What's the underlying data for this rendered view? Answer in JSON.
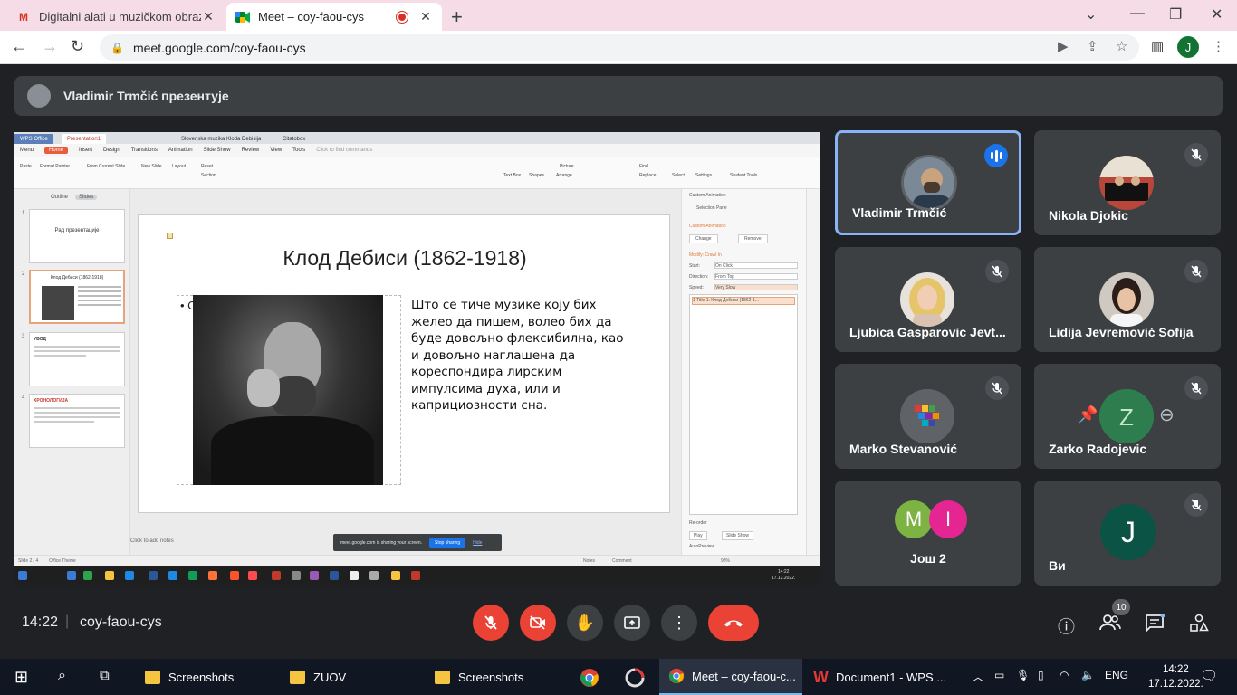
{
  "browser": {
    "tabs": [
      {
        "title": "Digitalni alati u muzičkom obrazc",
        "favicon": "gmail-icon"
      },
      {
        "title": "Meet – coy-faou-cys",
        "favicon": "meet-icon"
      }
    ],
    "url": "meet.google.com/coy-faou-cys",
    "profile_initial": "J"
  },
  "meet": {
    "presenter_text": "Vladimir Trmčić презентује",
    "time": "14:22",
    "separator": "|",
    "meeting_code": "coy-faou-cys",
    "participant_count": "10",
    "participants": [
      {
        "name": "Vladimir Trmčić",
        "status": "speaking"
      },
      {
        "name": "Nikola Djokic",
        "status": "muted"
      },
      {
        "name": "Ljubica Gasparovic Jevt...",
        "status": "muted"
      },
      {
        "name": "Lidija Jevremović Sofija",
        "status": "muted"
      },
      {
        "name": "Marko Stevanović",
        "status": "muted"
      },
      {
        "name": "Zarko Radojevic",
        "status": "muted"
      },
      {
        "name": "Још 2",
        "initials": [
          "M",
          "I"
        ]
      },
      {
        "name": "Ви",
        "initial": "J",
        "status": "muted"
      }
    ]
  },
  "shared": {
    "wps_tabs": [
      "WPS Office",
      "Presentation1",
      "Slovenska muzika Kloda Debisija",
      "Citatobox"
    ],
    "menu": [
      "Menu",
      "Home",
      "Insert",
      "Design",
      "Transitions",
      "Animation",
      "Slide Show",
      "Review",
      "View",
      "Tools",
      "Click to find commands"
    ],
    "ribbon": [
      "Paste",
      "Format Painter",
      "From Current Slide",
      "New Slide",
      "Layout",
      "Reset",
      "Section",
      "Picture",
      "Text Box",
      "Shapes",
      "Arrange",
      "Find",
      "Replace",
      "Select",
      "Settings",
      "Student Tools"
    ],
    "outline_tab": "Outline",
    "slides_tab": "Slides",
    "thumbnails": [
      {
        "num": "1",
        "title": "Рад презентације"
      },
      {
        "num": "2",
        "title": "Клод Дебиси (1862-1918)"
      },
      {
        "num": "3",
        "title": "УВОД"
      },
      {
        "num": "4",
        "title": "ХРОНОЛОГИЈА"
      }
    ],
    "slide": {
      "title": "Клод Дебиси (1862-1918)",
      "bullet": "• С",
      "lines": [
        "Што се тиче музике коју бих",
        "желео да пишем, волео бих да",
        "буде довољно флексибилна, као",
        "и довољно наглашена да",
        "кореспондира лирским",
        "импулсима духа, или и",
        "каприциозности сна."
      ]
    },
    "anim_pane": {
      "title": "Custom Animation",
      "selection_pane": "Selection Pane",
      "section": "Custom Animation",
      "change": "Change",
      "remove": "Remove",
      "modify": "Modify: Crawl In",
      "start_label": "Start:",
      "start_value": "On Click",
      "direction_label": "Direction:",
      "direction_value": "From Top",
      "speed_label": "Speed:",
      "speed_value": "Very Slow",
      "list_item": "1  Title 1: Клод Дебиси (1862-1...",
      "reorder": "Re-order",
      "play": "Play",
      "slideshow": "Slide Show",
      "autopreview": "AutoPreview"
    },
    "notes_placeholder": "Click to add notes",
    "status_left": "Slide 2 / 4",
    "status_theme": "Office Theme",
    "status_notes": "Notes",
    "status_comment": "Comment",
    "zoom": "98%",
    "sharing_text": "meet.google.com is sharing your screen.",
    "stop_sharing": "Stop sharing",
    "hide": "Hide",
    "inner_clock_time": "14:22",
    "inner_clock_date": "17.12.2022."
  },
  "taskbar": {
    "items": [
      "Screenshots",
      "ZUOV",
      "Screenshots",
      "Meet – coy-faou-c...",
      "Document1 - WPS ..."
    ],
    "lang": "ENG",
    "time": "14:22",
    "date": "17.12.2022."
  }
}
